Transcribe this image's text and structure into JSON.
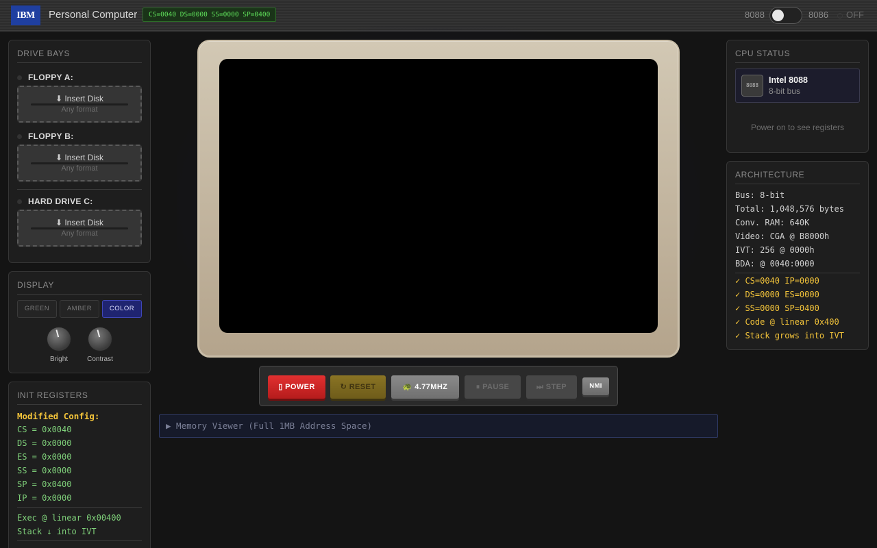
{
  "header": {
    "logo": "IBM",
    "title": "Personal Computer",
    "registers_badge": "CS=0040 DS=0000 SS=0000 SP=0400",
    "cpu_left": "8088",
    "cpu_right": "8086",
    "power_state": "OFF"
  },
  "drive_bays": {
    "title": "DRIVE BAYS",
    "drives": [
      {
        "label": "FLOPPY A:",
        "insert": "⬇ Insert Disk",
        "format": "Any format"
      },
      {
        "label": "FLOPPY B:",
        "insert": "⬇ Insert Disk",
        "format": "Any format"
      },
      {
        "label": "HARD DRIVE C:",
        "insert": "⬇ Insert Disk",
        "format": "Any format"
      }
    ]
  },
  "display": {
    "title": "DISPLAY",
    "modes": [
      "GREEN",
      "AMBER",
      "COLOR"
    ],
    "active_mode": "COLOR",
    "knobs": [
      "Bright",
      "Contrast"
    ]
  },
  "init_registers": {
    "title": "INIT REGISTERS",
    "subtitle": "Modified Config:",
    "lines": [
      "CS = 0x0040",
      "DS = 0x0000",
      "ES = 0x0000",
      "SS = 0x0000",
      "SP = 0x0400",
      "IP = 0x0000"
    ],
    "notes": [
      "Exec @ linear 0x00400",
      "Stack ↓ into IVT"
    ]
  },
  "controls": {
    "power": "▯ POWER",
    "reset": "↻ RESET",
    "speed": "🐢 4.77MHZ",
    "pause": "⏸ PAUSE",
    "step": "⏭ STEP",
    "nmi": "NMI"
  },
  "memory_viewer": {
    "label": "▶ Memory Viewer (Full 1MB Address Space)"
  },
  "cpu_status": {
    "title": "CPU STATUS",
    "chip_label": "8088",
    "name": "Intel 8088",
    "bus": "8-bit bus",
    "hint": "Power on to see registers"
  },
  "architecture": {
    "title": "ARCHITECTURE",
    "lines": [
      "Bus: 8-bit",
      "Total: 1,048,576 bytes",
      "Conv. RAM: 640K",
      "Video: CGA @ B8000h",
      "IVT: 256 @ 0000h",
      "BDA: @ 0040:0000"
    ],
    "checks": [
      "✓ CS=0040 IP=0000",
      "✓ DS=0000 ES=0000",
      "✓ SS=0000 SP=0400",
      "✓ Code @ linear 0x400",
      "✓ Stack grows into IVT"
    ]
  },
  "colors": {
    "accent_blue": "#1f3fa0",
    "register_green": "#5fe05a",
    "warning_yellow": "#f2c33a",
    "power_red": "#e23030",
    "bezel_beige": "#c9bda6"
  }
}
